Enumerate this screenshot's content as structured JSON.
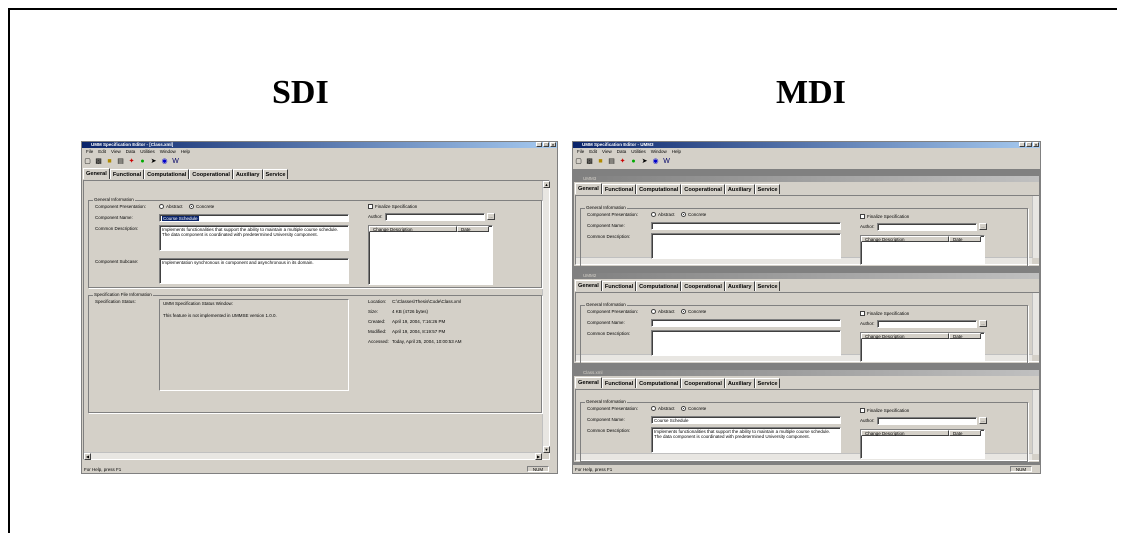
{
  "slide": {
    "sdi_title": "SDI",
    "mdi_title": "MDI"
  },
  "sdi": {
    "window_title": "UMM Specification Editor - [Class.xml]",
    "window_buttons": [
      "_",
      "□",
      "×"
    ],
    "menu": [
      "File",
      "Edit",
      "View",
      "Data",
      "Utilities",
      "Window",
      "Help"
    ],
    "tabs": [
      "General",
      "Functional",
      "Computational",
      "Cooperational",
      "Auxiliary",
      "Service"
    ],
    "general_group": "General Information",
    "presentation_label": "Component Presentation:",
    "abstract_label": "Abstract",
    "concrete_label": "Concrete",
    "name_label": "Component Name:",
    "name_value": "Course Schedule",
    "description_label": "Common Description:",
    "description_value": "Implements functionalities that support the ability to maintain a multiple course schedule. The data component is coordinated with predetermined University component.",
    "subcase_label": "Component Subcase:",
    "subcase_value": "Implementation synchronous in component and asynchronous in its domain.",
    "finalize_label": "Finalize Specification",
    "author_label": "Author:",
    "change_header": "Change Description",
    "date_header": "Date",
    "spec_group": "Specification File Information",
    "spec_status_label": "Specification Status:",
    "status_window_title": "UMM Specification Status Window:",
    "status_text": "This feature is not implemented in UMMSE version 1.0.0.",
    "location_label": "Location:",
    "location_value": "C:\\Classes\\Thesis\\Code\\Class.xml",
    "size_label": "Size:",
    "size_value": "4 KB (4726 bytes)",
    "created_label": "Created:",
    "created_value": "April 19, 2004, 7:16:26 PM",
    "modified_label": "Modified:",
    "modified_value": "April 19, 2004, 8:19:57 PM",
    "accessed_label": "Accessed:",
    "accessed_value": "Today, April 25, 2004, 10:00:53 AM",
    "status_bar": "For Help, press F1",
    "num_indicator": "NUM"
  },
  "mdi": {
    "window_title": "UMM Specification Editor - UMM3",
    "menu": [
      "File",
      "Edit",
      "View",
      "Data",
      "Utilities",
      "Window",
      "Help"
    ],
    "tabs": [
      "General",
      "Functional",
      "Computational",
      "Cooperational",
      "Auxiliary",
      "Service"
    ],
    "child_titles": [
      "UMM3",
      "UMM2",
      "Class.xml"
    ],
    "general_group": "General Information",
    "presentation_label": "Component Presentation:",
    "abstract_label": "Abstract",
    "concrete_label": "Concrete",
    "name_label": "Component Name:",
    "description_label": "Common Description:",
    "finalize_label": "Finalize Specification",
    "author_label": "Author:",
    "change_header": "Change Description",
    "date_header": "Date",
    "child3_name_value": "Course Schedule",
    "child3_description_value": "Implements functionalities that support the ability to maintain a multiple course schedule. The data component is coordinated with predetermined University component.",
    "status_bar": "For Help, press F1",
    "num_indicator": "NUM"
  },
  "colors": {
    "title_bar": "#0a246a",
    "face": "#d4d0c8",
    "inactive_title": "#808080"
  },
  "icons": [
    "new-file-icon",
    "save-icon",
    "open-folder-icon",
    "print-icon",
    "help-icon",
    "pointer-icon",
    "world-icon"
  ]
}
